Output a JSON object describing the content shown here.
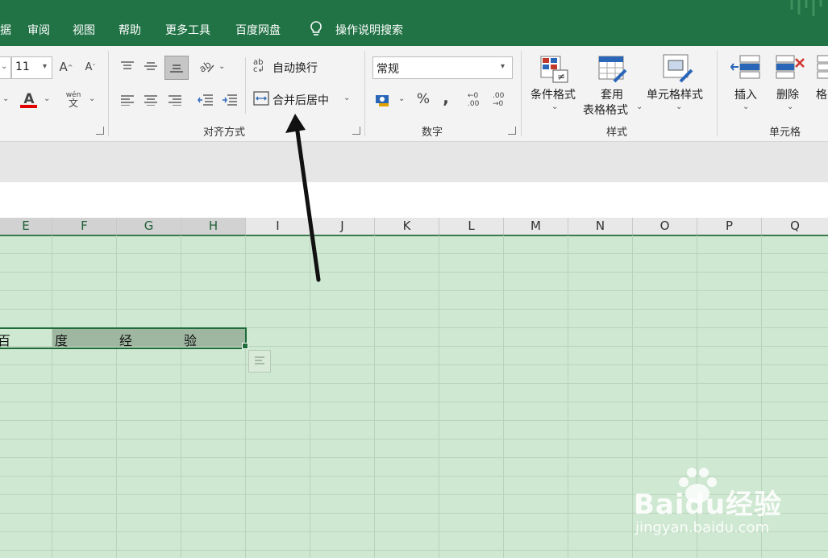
{
  "tabs": [
    "据",
    "审阅",
    "视图",
    "帮助",
    "更多工具",
    "百度网盘"
  ],
  "tell_me": "操作说明搜索",
  "font": {
    "size": "11"
  },
  "alignment": {
    "wrap_text": "自动换行",
    "merge_center": "合并后居中",
    "group_label": "对齐方式"
  },
  "number": {
    "format_value": "常规",
    "group_label": "数字",
    "percent": "%",
    "comma": ",",
    "inc_decimal": "←0 .00",
    "dec_decimal": ".00 →0"
  },
  "styles": {
    "conditional": "条件格式",
    "table_style_line1": "套用",
    "table_style_line2": "表格格式",
    "cell_styles": "单元格样式",
    "group_label": "样式"
  },
  "cells": {
    "insert": "插入",
    "delete": "删除",
    "format": "格",
    "group_label": "单元格"
  },
  "columns": [
    "E",
    "F",
    "G",
    "H",
    "I",
    "J",
    "K",
    "L",
    "M",
    "N",
    "O",
    "P",
    "Q"
  ],
  "row_values": [
    "百",
    "度",
    "经",
    "验"
  ],
  "watermark": {
    "brand": "Baidu经验",
    "url": "jingyan.baidu.com"
  },
  "colors": {
    "excel_green": "#217346",
    "sheet_bg": "#cfe8d2",
    "selection": "#9fb7a1"
  }
}
